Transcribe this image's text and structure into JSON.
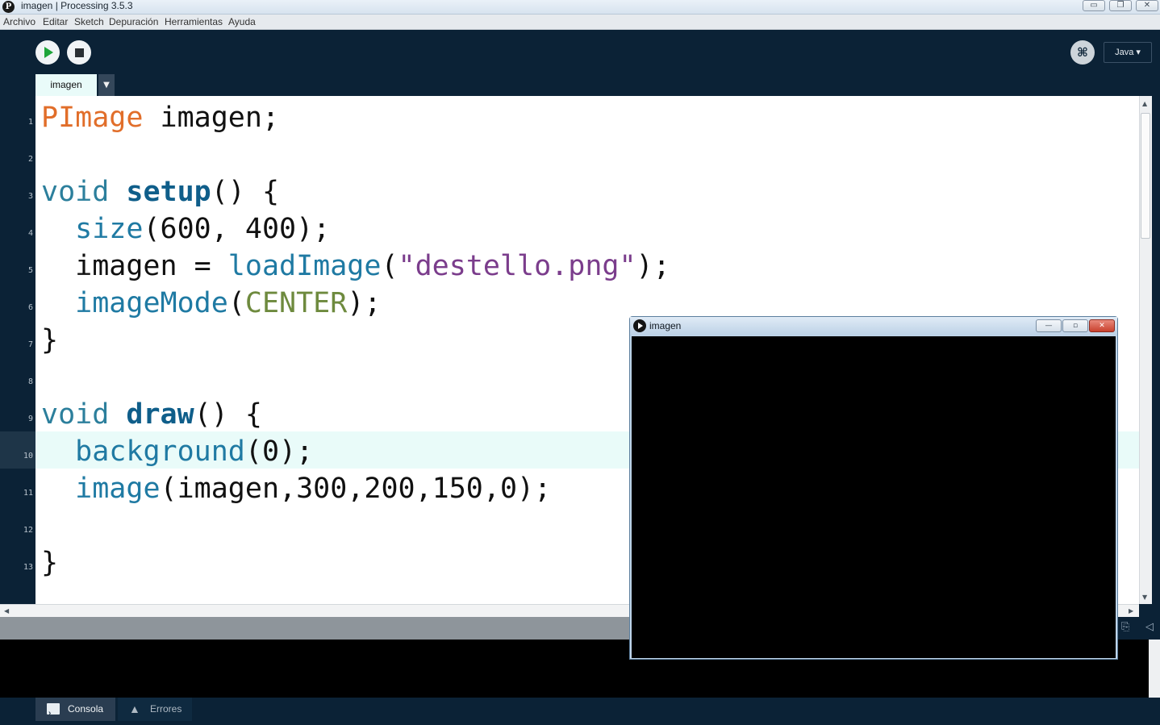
{
  "window": {
    "title": "imagen | Processing 3.5.3",
    "app_icon": "P",
    "controls": {
      "minimize": "▭",
      "maximize": "❐",
      "close": "✕"
    }
  },
  "menu": [
    "Archivo",
    "Editar",
    "Sketch",
    "Depuración",
    "Herramientas",
    "Ayuda"
  ],
  "toolbar": {
    "run_icon": "play-icon",
    "stop_icon": "stop-icon",
    "debug_glyph": "⌘",
    "mode_label": "Java ▾"
  },
  "tabs": [
    {
      "label": "imagen"
    }
  ],
  "tab_menu_glyph": "▼",
  "editor": {
    "line_numbers": [
      "1",
      "2",
      "3",
      "4",
      "5",
      "6",
      "7",
      "8",
      "9",
      "10",
      "11",
      "12",
      "13"
    ],
    "current_line": 10,
    "lines": [
      [
        {
          "t": "PImage",
          "c": "kw-type"
        },
        {
          "t": " imagen;"
        }
      ],
      [],
      [
        {
          "t": "void",
          "c": "kw-void"
        },
        {
          "t": " "
        },
        {
          "t": "setup",
          "c": "kw-fn"
        },
        {
          "t": "() {"
        }
      ],
      [
        {
          "t": "  "
        },
        {
          "t": "size",
          "c": "kw-call"
        },
        {
          "t": "(600, 400);"
        }
      ],
      [
        {
          "t": "  imagen = "
        },
        {
          "t": "loadImage",
          "c": "kw-call"
        },
        {
          "t": "("
        },
        {
          "t": "\"destello.png\"",
          "c": "kw-str"
        },
        {
          "t": ");"
        }
      ],
      [
        {
          "t": "  "
        },
        {
          "t": "imageMode",
          "c": "kw-call"
        },
        {
          "t": "("
        },
        {
          "t": "CENTER",
          "c": "kw-const"
        },
        {
          "t": ");"
        }
      ],
      [
        {
          "t": "}"
        }
      ],
      [],
      [
        {
          "t": "void",
          "c": "kw-void"
        },
        {
          "t": " "
        },
        {
          "t": "draw",
          "c": "kw-fn"
        },
        {
          "t": "() {"
        }
      ],
      [
        {
          "t": "  "
        },
        {
          "t": "background",
          "c": "kw-call"
        },
        {
          "t": "(0);"
        }
      ],
      [
        {
          "t": "  "
        },
        {
          "t": "image",
          "c": "kw-call"
        },
        {
          "t": "(imagen,300,200,150,0);"
        }
      ],
      [],
      [
        {
          "t": "}"
        }
      ]
    ]
  },
  "bottom_tabs": {
    "console": "Consola",
    "errors": "Errores"
  },
  "sketch_window": {
    "title": "imagen",
    "controls": {
      "minimize": "—",
      "maximize": "▫",
      "close": "✕"
    }
  },
  "colors": {
    "chrome_dark": "#0b2236",
    "tab_active": "#e9fbf9",
    "type_keyword": "#e16e2a",
    "function_call": "#1f7aa3",
    "string": "#7b3d8c",
    "constant": "#6e8a3e"
  }
}
